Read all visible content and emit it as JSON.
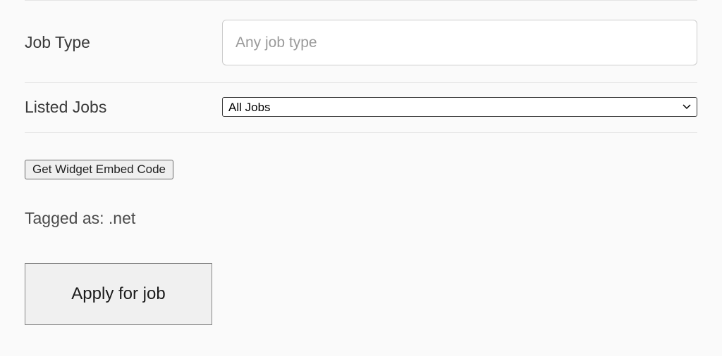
{
  "form": {
    "jobType": {
      "label": "Job Type",
      "placeholder": "Any job type",
      "value": ""
    },
    "listedJobs": {
      "label": "Listed Jobs",
      "selected": "All Jobs"
    }
  },
  "actions": {
    "widgetButton": "Get Widget Embed Code",
    "applyButton": "Apply for job"
  },
  "tagged": {
    "label": "Tagged as: ",
    "tag": ".net"
  }
}
